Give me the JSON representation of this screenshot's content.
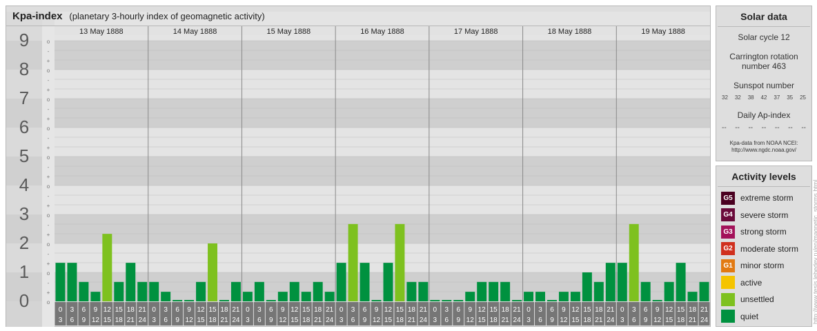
{
  "header": {
    "title": "Kpa-index",
    "subtitle": "(planetary 3-hourly index of geomagnetic activity)"
  },
  "chart_data": {
    "type": "bar",
    "title": "Kpa-index",
    "subtitle": "(planetary 3-hourly index of geomagnetic activity)",
    "ylim": [
      0,
      9
    ],
    "y_ticks": [
      "0",
      "1",
      "2",
      "3",
      "4",
      "5",
      "6",
      "7",
      "8",
      "9"
    ],
    "y_minor_ticks": [
      "o",
      "+",
      "-"
    ],
    "days": [
      "13 May 1888",
      "14 May 1888",
      "15 May 1888",
      "16 May 1888",
      "17 May 1888",
      "18 May 1888",
      "19 May 1888"
    ],
    "interval_start_hours": [
      "0",
      "3",
      "6",
      "9",
      "12",
      "15",
      "18",
      "21"
    ],
    "interval_end_hours": [
      "3",
      "6",
      "9",
      "12",
      "15",
      "18",
      "21",
      "24"
    ],
    "values": [
      [
        1.33,
        1.33,
        0.67,
        0.33,
        2.33,
        0.67,
        1.33,
        0.67
      ],
      [
        0.67,
        0.33,
        0,
        0,
        0.67,
        2,
        0,
        0.67
      ],
      [
        0.33,
        0.67,
        0,
        0.33,
        0.67,
        0.33,
        0.67,
        0.33
      ],
      [
        1.33,
        2.67,
        1.33,
        0,
        1.33,
        2.67,
        0.67,
        0.67
      ],
      [
        0,
        0,
        0,
        0.33,
        0.67,
        0.67,
        0.67,
        0
      ],
      [
        0.33,
        0.33,
        0,
        0.33,
        0.33,
        1,
        0.67,
        1.33
      ],
      [
        1.33,
        2.67,
        0.67,
        0,
        0.67,
        1.33,
        0.33,
        0.67
      ]
    ],
    "level_colors": {
      "quiet": "#00913f",
      "unsettled": "#7ec11f",
      "active": "#f5c400"
    },
    "grid": true
  },
  "solar": {
    "title": "Solar data",
    "cycle": "Solar cycle 12",
    "carrington_line1": "Carrington rotation",
    "carrington_line2": "number 463",
    "sunspot_title": "Sunspot number",
    "sunspots": [
      "32",
      "32",
      "38",
      "42",
      "37",
      "35",
      "25"
    ],
    "ap_title": "Daily Ap-index",
    "ap_values": [
      "--",
      "--",
      "--",
      "--",
      "--",
      "--",
      "--"
    ],
    "source_line1": "Kpa-data from NOAA NCEI:",
    "source_line2": "http://www.ngdc.noaa.gov/"
  },
  "activity": {
    "title": "Activity levels",
    "levels": [
      {
        "code": "G5",
        "label": "extreme storm",
        "color": "#4a0020"
      },
      {
        "code": "G4",
        "label": "severe storm",
        "color": "#6a0a3a"
      },
      {
        "code": "G3",
        "label": "strong storm",
        "color": "#a3125a"
      },
      {
        "code": "G2",
        "label": "moderate storm",
        "color": "#d0301e"
      },
      {
        "code": "G1",
        "label": "minor storm",
        "color": "#e27a12"
      },
      {
        "code": "",
        "label": "active",
        "color": "#f5c400"
      },
      {
        "code": "",
        "label": "unsettled",
        "color": "#7ec11f"
      },
      {
        "code": "",
        "label": "quiet",
        "color": "#00913f"
      }
    ]
  },
  "credit": "http://www.tesis.lebedev.ru/en/magnetic_storms.html"
}
